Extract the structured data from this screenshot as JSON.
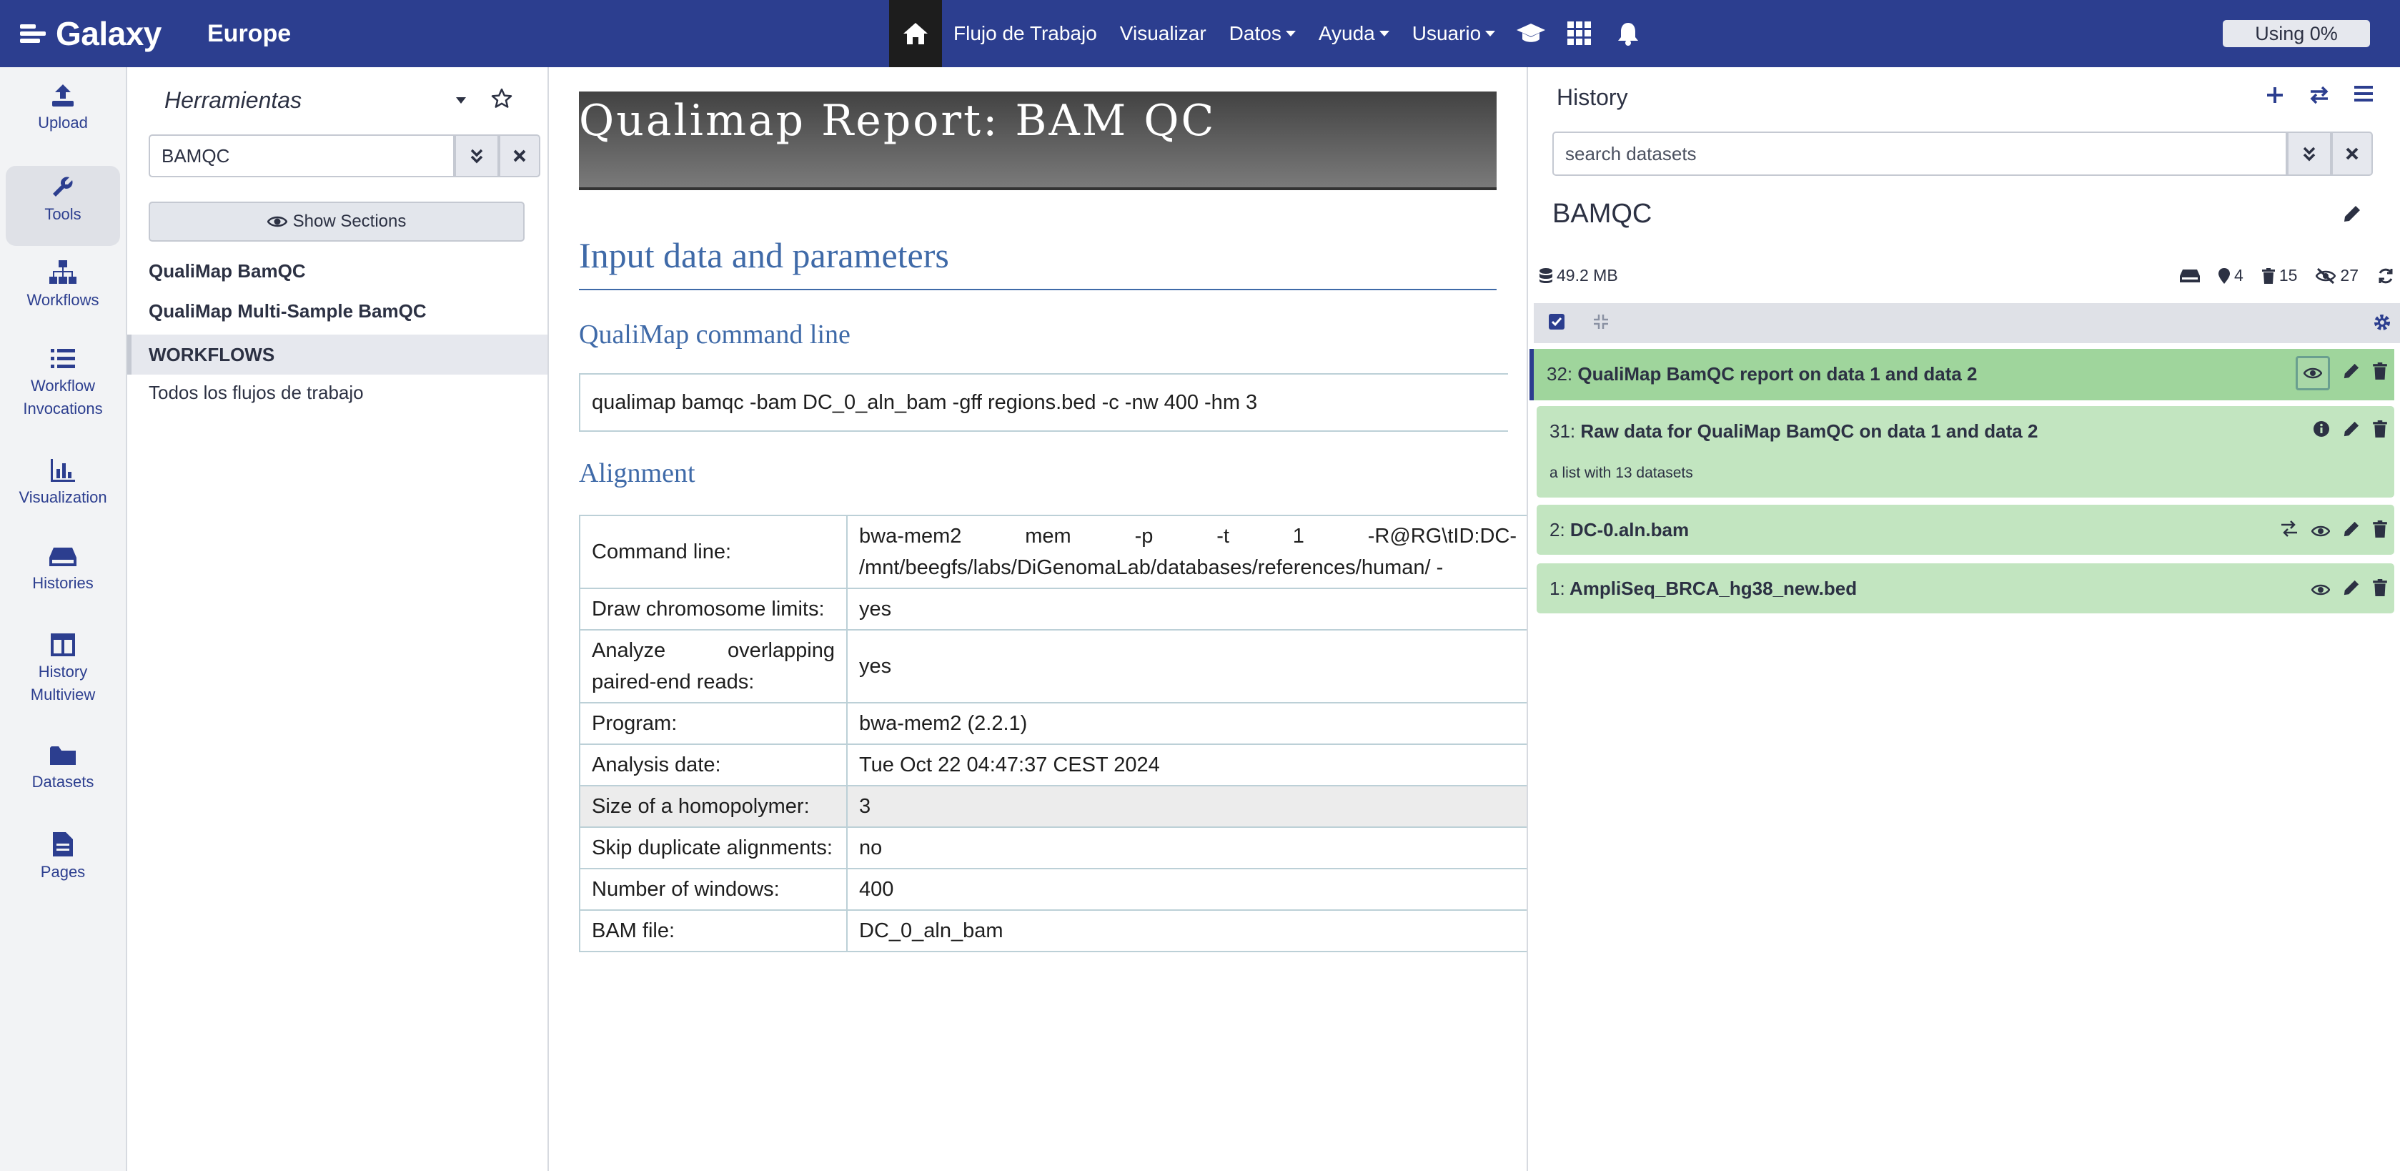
{
  "masthead": {
    "brand": "Galaxy",
    "brand_sub": "Europe",
    "nav": [
      "Flujo de Trabajo",
      "Visualizar",
      "Datos",
      "Ayuda",
      "Usuario"
    ],
    "quota": "Using 0%",
    "colors": {
      "bar": "#2c3e8f",
      "home_bg": "#1d1d1d"
    }
  },
  "activity": [
    {
      "label": "Upload",
      "icon": "upload-icon"
    },
    {
      "label": "Tools",
      "icon": "wrench-icon",
      "active": true
    },
    {
      "label": "Workflows",
      "icon": "sitemap-icon"
    },
    {
      "label": "Workflow Invocations",
      "icon": "list-icon"
    },
    {
      "label": "Visualization",
      "icon": "chart-bar-icon"
    },
    {
      "label": "Histories",
      "icon": "hdd-icon"
    },
    {
      "label": "History Multiview",
      "icon": "columns-icon"
    },
    {
      "label": "Datasets",
      "icon": "folder-icon"
    },
    {
      "label": "Pages",
      "icon": "file-icon"
    }
  ],
  "tools": {
    "title": "Herramientas",
    "search_value": "BAMQC",
    "show_sections": "Show Sections",
    "results": [
      "QualiMap BamQC",
      "QualiMap Multi-Sample BamQC"
    ],
    "section": "WORKFLOWS",
    "section_link": "Todos los flujos de trabajo"
  },
  "report": {
    "header": "Qualimap Report: BAM QC",
    "input_heading": "Input data and parameters",
    "cmd_heading": "QualiMap command line",
    "cmd": "qualimap bamqc -bam DC_0_aln_bam -gff regions.bed -c -nw 400 -hm 3",
    "align_heading": "Alignment",
    "params": [
      {
        "k": "Command line:",
        "v": "bwa-mem2 mem -p -t 1 -R@RG\\tID:DC- /mnt/beegfs/labs/DiGenomaLab/databases/references/human/ -"
      },
      {
        "k": "Draw chromosome limits:",
        "v": "yes"
      },
      {
        "k": "Analyze overlapping paired-end reads:",
        "v": "yes"
      },
      {
        "k": "Program:",
        "v": "bwa-mem2 (2.2.1)"
      },
      {
        "k": "Analysis date:",
        "v": "Tue Oct 22 04:47:37 CEST 2024"
      },
      {
        "k": "Size of a homopolymer:",
        "v": "3",
        "shade": true
      },
      {
        "k": "Skip duplicate alignments:",
        "v": "no"
      },
      {
        "k": "Number of windows:",
        "v": "400"
      },
      {
        "k": "BAM file:",
        "v": "DC_0_aln_bam"
      }
    ]
  },
  "history": {
    "title": "History",
    "search_placeholder": "search datasets",
    "name": "BAMQC",
    "size": "49.2 MB",
    "counts": {
      "shown": "4",
      "deleted": "15",
      "hidden": "27"
    },
    "datasets": [
      {
        "hid": "32:",
        "name": "QualiMap BamQC report on data 1 and data 2",
        "state": "ok",
        "focus": true
      },
      {
        "hid": "31:",
        "name": "Raw data for QualiMap BamQC on data 1 and data 2",
        "sub": "a list with 13 datasets",
        "state": "ok"
      },
      {
        "hid": "2:",
        "name": "DC-0.aln.bam",
        "state": "ok"
      },
      {
        "hid": "1:",
        "name": "AmpliSeq_BRCA_hg38_new.bed",
        "state": "ok"
      }
    ]
  }
}
